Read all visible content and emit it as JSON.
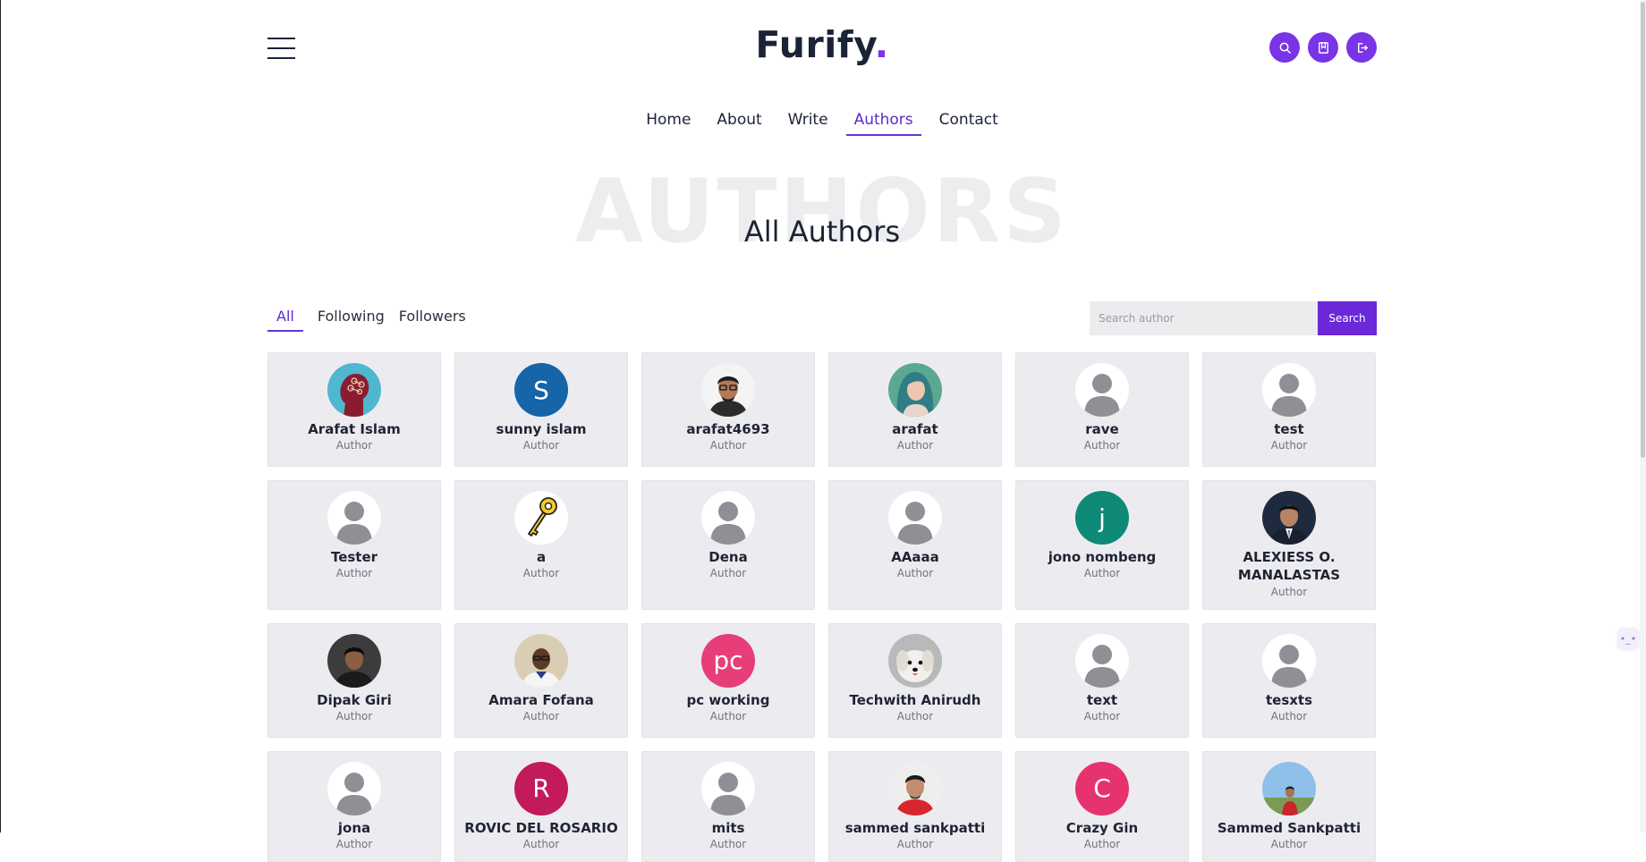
{
  "brand": {
    "name": "Furify",
    "dot": ".",
    "accent": "#7a34e8"
  },
  "header": {
    "icons": [
      "search-icon",
      "bookmark-icon",
      "logout-icon"
    ]
  },
  "nav": {
    "items": [
      {
        "label": "Home",
        "active": false
      },
      {
        "label": "About",
        "active": false
      },
      {
        "label": "Write",
        "active": false
      },
      {
        "label": "Authors",
        "active": true
      },
      {
        "label": "Contact",
        "active": false
      }
    ]
  },
  "page": {
    "background_title": "AUTHORS",
    "title": "All Authors"
  },
  "filters": {
    "tabs": [
      {
        "label": "All",
        "active": true
      },
      {
        "label": "Following",
        "active": false
      },
      {
        "label": "Followers",
        "active": false
      }
    ]
  },
  "search": {
    "placeholder": "Search author",
    "button_label": "Search"
  },
  "authors": [
    {
      "name": "Arafat Islam",
      "role": "Author",
      "avatar": "photo-brain"
    },
    {
      "name": "sunny islam",
      "role": "Author",
      "avatar": "letter",
      "letter": "S",
      "color": "#1565a8"
    },
    {
      "name": "arafat4693",
      "role": "Author",
      "avatar": "photo-man-glasses"
    },
    {
      "name": "arafat",
      "role": "Author",
      "avatar": "photo-woman"
    },
    {
      "name": "rave",
      "role": "Author",
      "avatar": "default"
    },
    {
      "name": "test",
      "role": "Author",
      "avatar": "default"
    },
    {
      "name": "Tester",
      "role": "Author",
      "avatar": "default"
    },
    {
      "name": "a",
      "role": "Author",
      "avatar": "key"
    },
    {
      "name": "Dena",
      "role": "Author",
      "avatar": "default"
    },
    {
      "name": "AAaaa",
      "role": "Author",
      "avatar": "default"
    },
    {
      "name": "jono nombeng",
      "role": "Author",
      "avatar": "letter",
      "letter": "j",
      "color": "#0f8a76"
    },
    {
      "name": "ALEXIESS O. MANALASTAS",
      "role": "Author",
      "avatar": "photo-man-suit"
    },
    {
      "name": "Dipak Giri",
      "role": "Author",
      "avatar": "photo-man-dark"
    },
    {
      "name": "Amara Fofana",
      "role": "Author",
      "avatar": "photo-man-light"
    },
    {
      "name": "pc working",
      "role": "Author",
      "avatar": "letter",
      "letter": "pc",
      "color": "#e73d78"
    },
    {
      "name": "Techwith Anirudh",
      "role": "Author",
      "avatar": "photo-dog"
    },
    {
      "name": "text",
      "role": "Author",
      "avatar": "default"
    },
    {
      "name": "tesxts",
      "role": "Author",
      "avatar": "default"
    },
    {
      "name": "jona",
      "role": "Author",
      "avatar": "default"
    },
    {
      "name": "ROVIC DEL ROSARIO",
      "role": "Author",
      "avatar": "letter",
      "letter": "R",
      "color": "#c21a5a"
    },
    {
      "name": "mits",
      "role": "Author",
      "avatar": "default"
    },
    {
      "name": "sammed sankpatti",
      "role": "Author",
      "avatar": "photo-man-red"
    },
    {
      "name": "Crazy Gin",
      "role": "Author",
      "avatar": "letter",
      "letter": "C",
      "color": "#e7336d"
    },
    {
      "name": "Sammed Sankpatti",
      "role": "Author",
      "avatar": "photo-man-outdoor"
    }
  ]
}
